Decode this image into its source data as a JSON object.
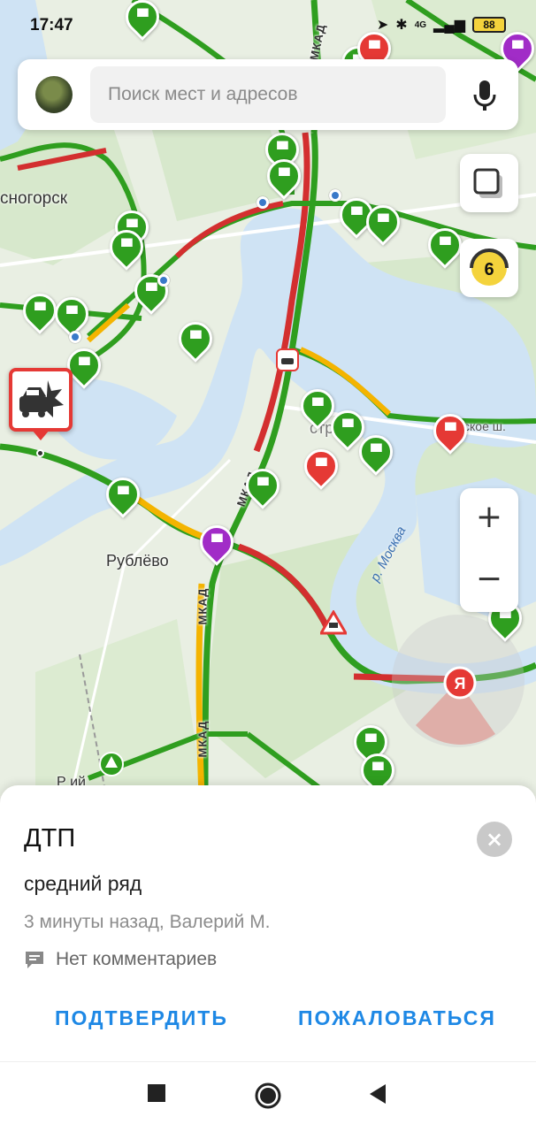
{
  "status": {
    "time": "17:47",
    "network": "4G",
    "battery": "88"
  },
  "search": {
    "placeholder": "Поиск мест и адресов"
  },
  "map": {
    "labels": {
      "krasnogorsk": "сногорск",
      "rublevo": "Рублёво",
      "strogino": "стр     ино",
      "river": "р. Москва",
      "street": "ское ш.",
      "mkad_1": "МКАД",
      "mkad_2": "МКАД",
      "mkad_3": "МКАД",
      "mkad_4": "МКАД",
      "park": "Р        ий"
    },
    "traffic_score": "6",
    "zoom_in": "+",
    "zoom_out": "−",
    "ya_logo": "Я"
  },
  "event": {
    "title": "ДТП",
    "subtitle": "средний ряд",
    "meta": "3 минуты назад, Валерий М.",
    "comments": "Нет комментариев",
    "close": "×",
    "confirm": "ПОДТВЕРДИТЬ",
    "report": "ПОЖАЛОВАТЬСЯ"
  },
  "colors": {
    "traffic_green": "#2f9e1f",
    "traffic_red": "#d32f2f",
    "traffic_yellow": "#f4b400",
    "accent_blue": "#1e88e5",
    "alert_red": "#e53935",
    "water": "#cfe3f4"
  }
}
